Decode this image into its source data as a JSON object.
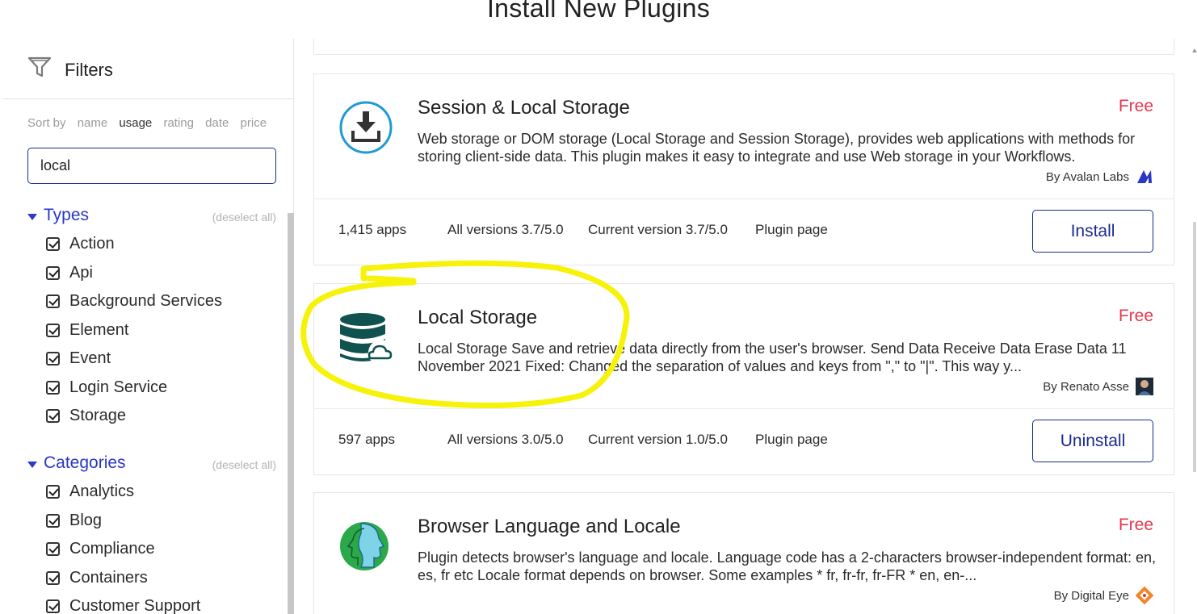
{
  "page": {
    "title": "Install New Plugins"
  },
  "sidebar": {
    "title": "Filters",
    "sort": {
      "label": "Sort by",
      "options": [
        "name",
        "usage",
        "rating",
        "date",
        "price"
      ],
      "active": "usage"
    },
    "search": {
      "value": "local"
    },
    "types": {
      "title": "Types",
      "deselect_label": "(deselect all)",
      "items": [
        "Action",
        "Api",
        "Background Services",
        "Element",
        "Event",
        "Login Service",
        "Storage"
      ]
    },
    "categories": {
      "title": "Categories",
      "deselect_label": "(deselect all)",
      "items": [
        "Analytics",
        "Blog",
        "Compliance",
        "Containers",
        "Customer Support"
      ]
    }
  },
  "plugins": [
    {
      "name": "Session & Local Storage",
      "price": "Free",
      "description": "Web storage or DOM storage (Local Storage and Session Storage), provides web applications with methods for storing client-side data. This plugin makes it easy to integrate and use Web storage in your Workflows.",
      "author": "By Avalan Labs",
      "apps": "1,415 apps",
      "all_versions": "All versions 3.7/5.0",
      "current_version": "Current version 3.7/5.0",
      "plugin_page": "Plugin page",
      "action": "Install",
      "icon": "download-icon"
    },
    {
      "name": "Local Storage",
      "price": "Free",
      "description": "Local Storage Save and retrieve data directly from the user's browser. Send Data Receive Data Erase Data 11 November 2021 Fixed: Changed the separation of values and keys from \",\" to \"|\". This way y...",
      "author": "By Renato Asse",
      "apps": "597 apps",
      "all_versions": "All versions 3.0/5.0",
      "current_version": "Current version 1.0/5.0",
      "plugin_page": "Plugin page",
      "action": "Uninstall",
      "icon": "database-cloud-icon"
    },
    {
      "name": "Browser Language and Locale",
      "price": "Free",
      "description": "Plugin detects browser's language and locale. Language code has a 2-characters browser-independent format: en, es, fr etc Locale format depends on browser. Some examples * fr, fr-fr, fr-FR * en, en-...",
      "author": "By Digital Eye",
      "icon": "faces-icon"
    }
  ],
  "colors": {
    "accent": "#1a2a8c",
    "link": "#2a36c4",
    "price": "#e5374f",
    "highlight": "#f7f20a"
  }
}
